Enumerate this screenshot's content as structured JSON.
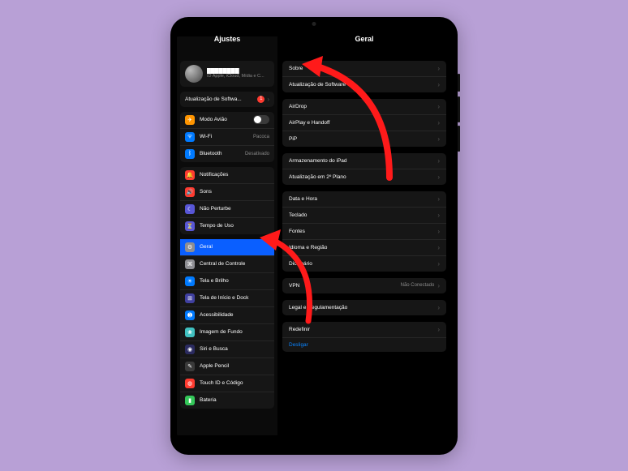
{
  "header": {
    "left_title": "Ajustes",
    "right_title": "Geral"
  },
  "profile": {
    "name": "████████",
    "subtitle": "ID Apple, iCloud, Mídia e C..."
  },
  "sw_update_banner": {
    "label": "Atualização de Softwa...",
    "badge": "1"
  },
  "sidebar": {
    "group1": [
      {
        "icon": "airplane-icon",
        "color": "#ff9500",
        "label": "Modo Avião",
        "kind": "toggle"
      },
      {
        "icon": "wifi-icon",
        "color": "#007aff",
        "label": "Wi-Fi",
        "value": "Pacoca"
      },
      {
        "icon": "bluetooth-icon",
        "color": "#007aff",
        "label": "Bluetooth",
        "value": "Desativado"
      }
    ],
    "group2": [
      {
        "icon": "bell-icon",
        "color": "#ff3b30",
        "label": "Notificações"
      },
      {
        "icon": "speaker-icon",
        "color": "#ff3b30",
        "label": "Sons"
      },
      {
        "icon": "moon-icon",
        "color": "#5856d6",
        "label": "Não Perturbe"
      },
      {
        "icon": "hourglass-icon",
        "color": "#5856d6",
        "label": "Tempo de Uso"
      }
    ],
    "group3": [
      {
        "icon": "gear-icon",
        "color": "#8e8e93",
        "label": "Geral",
        "selected": true
      },
      {
        "icon": "control-icon",
        "color": "#8e8e93",
        "label": "Central de Controle"
      },
      {
        "icon": "brightness-icon",
        "color": "#007aff",
        "label": "Tela e Brilho"
      },
      {
        "icon": "home-icon",
        "color": "#4040a0",
        "label": "Tela de Início e Dock"
      },
      {
        "icon": "accessibility-icon",
        "color": "#007aff",
        "label": "Acessibilidade"
      },
      {
        "icon": "wallpaper-icon",
        "color": "#40c0c0",
        "label": "Imagem de Fundo"
      },
      {
        "icon": "siri-icon",
        "color": "#2b2b60",
        "label": "Siri e Busca"
      },
      {
        "icon": "pencil-icon",
        "color": "#3a3a3a",
        "label": "Apple Pencil"
      },
      {
        "icon": "touchid-icon",
        "color": "#ff3b30",
        "label": "Touch ID e Código"
      },
      {
        "icon": "battery-icon",
        "color": "#34c759",
        "label": "Bateria"
      }
    ]
  },
  "right": {
    "g1": [
      {
        "label": "Sobre"
      },
      {
        "label": "Atualização de Software"
      }
    ],
    "g2": [
      {
        "label": "AirDrop"
      },
      {
        "label": "AirPlay e Handoff"
      },
      {
        "label": "PiP"
      }
    ],
    "g3": [
      {
        "label": "Armazenamento do iPad"
      },
      {
        "label": "Atualização em 2º Plano"
      }
    ],
    "g4": [
      {
        "label": "Data e Hora"
      },
      {
        "label": "Teclado"
      },
      {
        "label": "Fontes"
      },
      {
        "label": "Idioma e Região"
      },
      {
        "label": "Dicionário"
      }
    ],
    "g5": [
      {
        "label": "VPN",
        "value": "Não Conectado"
      }
    ],
    "g6": [
      {
        "label": "Legal e Regulamentação"
      }
    ],
    "g7": [
      {
        "label": "Redefinir"
      },
      {
        "label": "Desligar",
        "destructive": true
      }
    ]
  },
  "icon_glyphs": {
    "airplane-icon": "✈",
    "wifi-icon": "ᯤ",
    "bluetooth-icon": "ᛒ",
    "bell-icon": "🔔",
    "speaker-icon": "🔊",
    "moon-icon": "☾",
    "hourglass-icon": "⏳",
    "gear-icon": "⚙",
    "control-icon": "⌘",
    "brightness-icon": "☀",
    "home-icon": "⊞",
    "accessibility-icon": "➊",
    "wallpaper-icon": "❀",
    "siri-icon": "◉",
    "pencil-icon": "✎",
    "touchid-icon": "◍",
    "battery-icon": "▮"
  }
}
